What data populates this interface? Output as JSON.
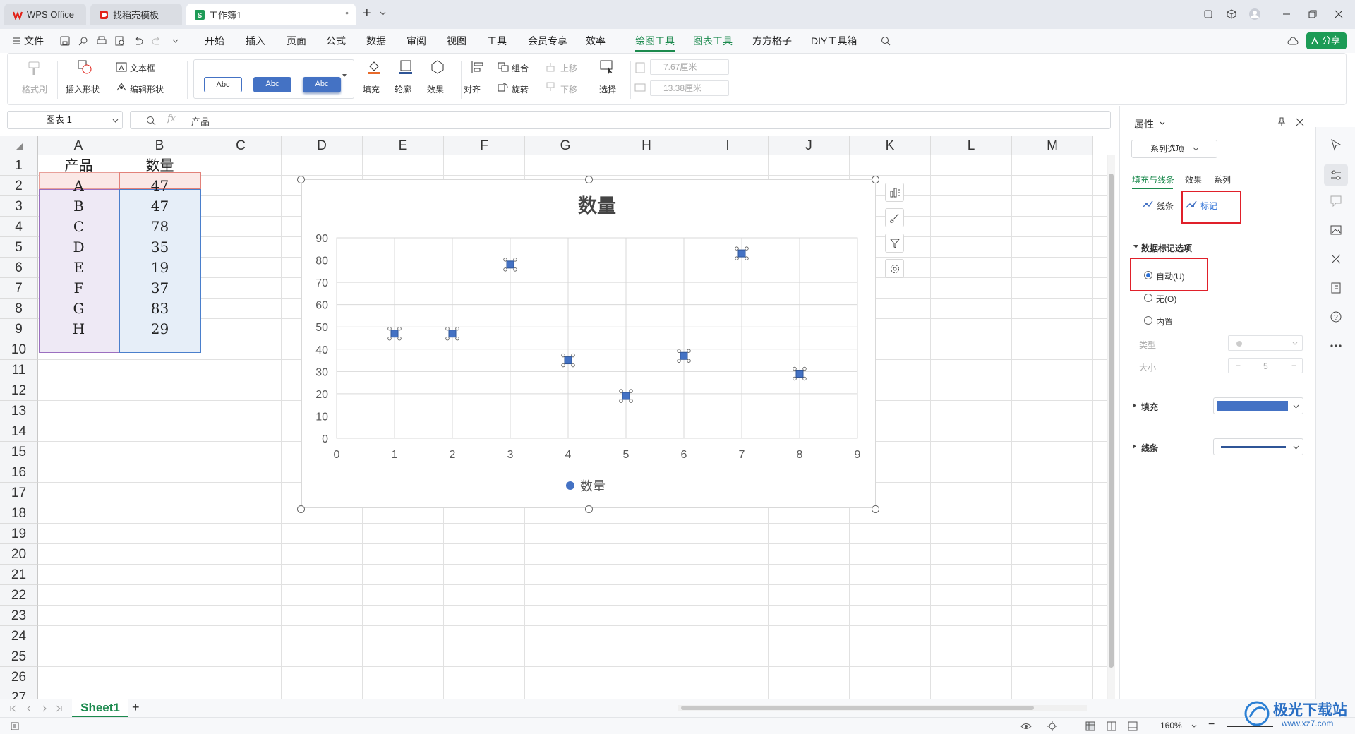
{
  "titlebar": {
    "tabs": [
      {
        "label": "WPS Office",
        "icon": "wps-logo-icon"
      },
      {
        "label": "找稻壳模板",
        "icon": "docer-icon"
      },
      {
        "label": "工作簿1",
        "icon": "spreadsheet-icon",
        "modified_dot": "•"
      }
    ],
    "new_tab": "+"
  },
  "menu": {
    "file": "文件",
    "items": [
      "开始",
      "插入",
      "页面",
      "公式",
      "数据",
      "审阅",
      "视图",
      "工具",
      "会员专享",
      "效率",
      "绘图工具",
      "图表工具",
      "方方格子",
      "DIY工具箱"
    ],
    "active": "绘图工具",
    "share": "分享"
  },
  "ribbon": {
    "format_painter": "格式刷",
    "insert_shape": "插入形状",
    "text_box": "文本框",
    "edit_shape": "编辑形状",
    "styles": [
      "Abc",
      "Abc",
      "Abc"
    ],
    "fill": "填充",
    "outline": "轮廓",
    "effects": "效果",
    "align": "对齐",
    "group": "组合",
    "rotate": "旋转",
    "bring_forward": "上移",
    "send_backward": "下移",
    "select": "选择",
    "height": "7.67厘米",
    "width": "13.38厘米"
  },
  "formula_bar": {
    "name_box": "图表 1",
    "fx": "fx",
    "content": "产品"
  },
  "sheet": {
    "columns": [
      "A",
      "B",
      "C",
      "D",
      "E",
      "F",
      "G",
      "H",
      "I",
      "J",
      "K",
      "L",
      "M"
    ],
    "rows": [
      "1",
      "2",
      "3",
      "4",
      "5",
      "6",
      "7",
      "8",
      "9",
      "10",
      "11",
      "12",
      "13",
      "14",
      "15",
      "16",
      "17",
      "18",
      "19",
      "20",
      "21",
      "22",
      "23",
      "24",
      "25",
      "26",
      "27"
    ],
    "header": [
      "产品",
      "数量"
    ],
    "data": [
      [
        "A",
        "47"
      ],
      [
        "B",
        "47"
      ],
      [
        "C",
        "78"
      ],
      [
        "D",
        "35"
      ],
      [
        "E",
        "19"
      ],
      [
        "F",
        "37"
      ],
      [
        "G",
        "83"
      ],
      [
        "H",
        "29"
      ]
    ]
  },
  "chart_data": {
    "type": "scatter",
    "title": "数量",
    "series": [
      {
        "name": "数量",
        "x": [
          1,
          2,
          3,
          4,
          5,
          6,
          7,
          8
        ],
        "y": [
          47,
          47,
          78,
          35,
          19,
          37,
          83,
          29
        ],
        "color": "#4472c4"
      }
    ],
    "xlim": [
      0,
      9
    ],
    "ylim": [
      0,
      90
    ],
    "x_ticks": [
      "0",
      "1",
      "2",
      "3",
      "4",
      "5",
      "6",
      "7",
      "8",
      "9"
    ],
    "y_ticks": [
      "0",
      "10",
      "20",
      "30",
      "40",
      "50",
      "60",
      "70",
      "80",
      "90"
    ],
    "grid": true,
    "legend": "bottom"
  },
  "panel": {
    "title": "属性",
    "series_dropdown": "系列选项",
    "tabs": [
      "填充与线条",
      "效果",
      "系列"
    ],
    "subtabs": [
      "线条",
      "标记"
    ],
    "section_title": "数据标记选项",
    "options": [
      "自动(U)",
      "无(O)",
      "内置"
    ],
    "selected": "自动(U)",
    "type_label": "类型",
    "size_label": "大小",
    "size_value": "5",
    "fill_label": "填充",
    "line_label": "线条",
    "fill_color": "#4472c4",
    "line_color": "#2f5597"
  },
  "sheets": {
    "active": "Sheet1",
    "add": "+"
  },
  "status": {
    "zoom": "160%"
  },
  "watermark": {
    "name": "极光下载站",
    "url": "www.xz7.com"
  }
}
